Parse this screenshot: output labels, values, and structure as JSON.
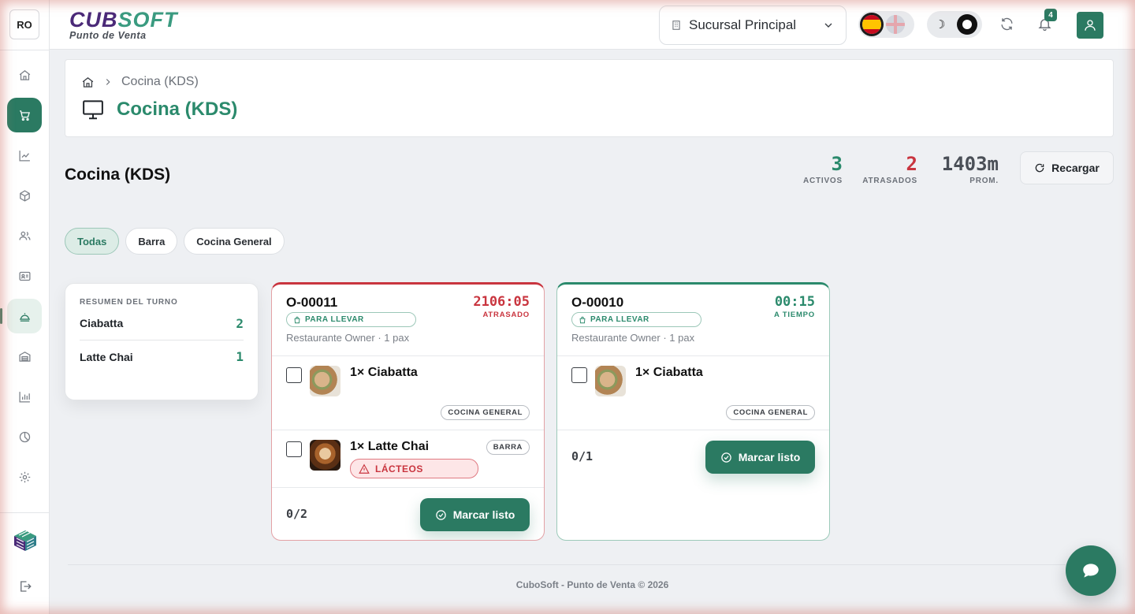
{
  "sidebar": {
    "avatar": "RO",
    "items": [
      {
        "icon": "home-icon"
      },
      {
        "icon": "cart-icon",
        "state": "active"
      },
      {
        "icon": "trend-icon"
      },
      {
        "icon": "box-icon"
      },
      {
        "icon": "users-icon"
      },
      {
        "icon": "id-card-icon"
      },
      {
        "icon": "cloche-icon",
        "state": "current"
      },
      {
        "icon": "warehouse-icon"
      },
      {
        "icon": "bar-chart-icon"
      },
      {
        "icon": "pie-chart-icon"
      },
      {
        "icon": "gear-icon"
      }
    ]
  },
  "header": {
    "brand_part1": "CUB",
    "brand_part2": "SOFT",
    "brand_subtitle": "Punto de Venta",
    "branch": "Sucursal Principal",
    "notification_count": "4"
  },
  "breadcrumb": {
    "current": "Cocina (KDS)",
    "page_title": "Cocina (KDS)"
  },
  "kds": {
    "title": "Cocina (KDS)",
    "stats": {
      "active_value": "3",
      "active_label": "ACTIVOS",
      "late_value": "2",
      "late_label": "ATRASADOS",
      "avg_value": "1403m",
      "avg_label": "PROM."
    },
    "reload_label": "Recargar",
    "filters": [
      "Todas",
      "Barra",
      "Cocina General"
    ],
    "summary": {
      "title": "RESUMEN DEL TURNO",
      "rows": [
        {
          "name": "Ciabatta",
          "count": "2"
        },
        {
          "name": "Latte Chai",
          "count": "1"
        }
      ]
    },
    "orders": [
      {
        "id": "O-00011",
        "type": "PARA LLEVAR",
        "meta": "Restaurante Owner · 1 pax",
        "time": "2106:05",
        "status": "ATRASADO",
        "items": [
          {
            "name": "1× Ciabatta",
            "station": "COCINA GENERAL"
          },
          {
            "name": "1× Latte Chai",
            "station": "BARRA",
            "allergen": "LÁCTEOS"
          }
        ],
        "progress": "0/2",
        "button": "Marcar listo"
      },
      {
        "id": "O-00010",
        "type": "PARA LLEVAR",
        "meta": "Restaurante Owner · 1 pax",
        "time": "00:15",
        "status": "A TIEMPO",
        "items": [
          {
            "name": "1× Ciabatta",
            "station": "COCINA GENERAL"
          }
        ],
        "progress": "0/1",
        "button": "Marcar listo"
      }
    ]
  },
  "footer": {
    "text": "CuboSoft - Punto de Venta © 2026"
  },
  "colors": {
    "primary": "#2b7a62",
    "danger": "#c9353f",
    "brand_purple": "#4b2a78"
  }
}
